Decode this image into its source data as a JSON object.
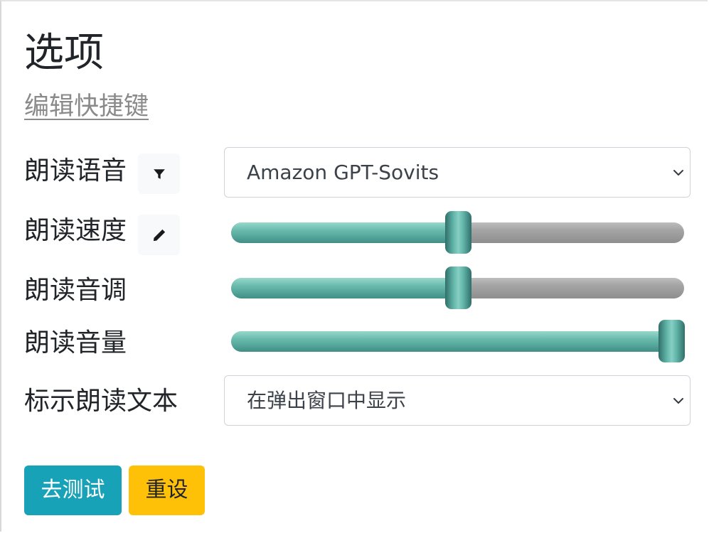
{
  "header": {
    "title": "选项",
    "shortcut_link": "编辑快捷键"
  },
  "voice": {
    "label": "朗读语音",
    "filter_icon": "filter-icon",
    "selected": "Amazon GPT-Sovits"
  },
  "rate": {
    "label": "朗读速度",
    "edit_icon": "pencil-icon",
    "value_fraction": 0.5
  },
  "pitch": {
    "label": "朗读音调",
    "value_fraction": 0.5
  },
  "volume": {
    "label": "朗读音量",
    "value_fraction": 1.0
  },
  "highlight": {
    "label": "标示朗读文本",
    "selected": "在弹出窗口中显示"
  },
  "buttons": {
    "test": "去测试",
    "reset": "重设"
  },
  "colors": {
    "test_button": "#17a2b8",
    "reset_button": "#ffc107",
    "slider_fill": "#6cbdb0",
    "slider_track": "#a5a5a5",
    "link": "#8a8a8a"
  }
}
